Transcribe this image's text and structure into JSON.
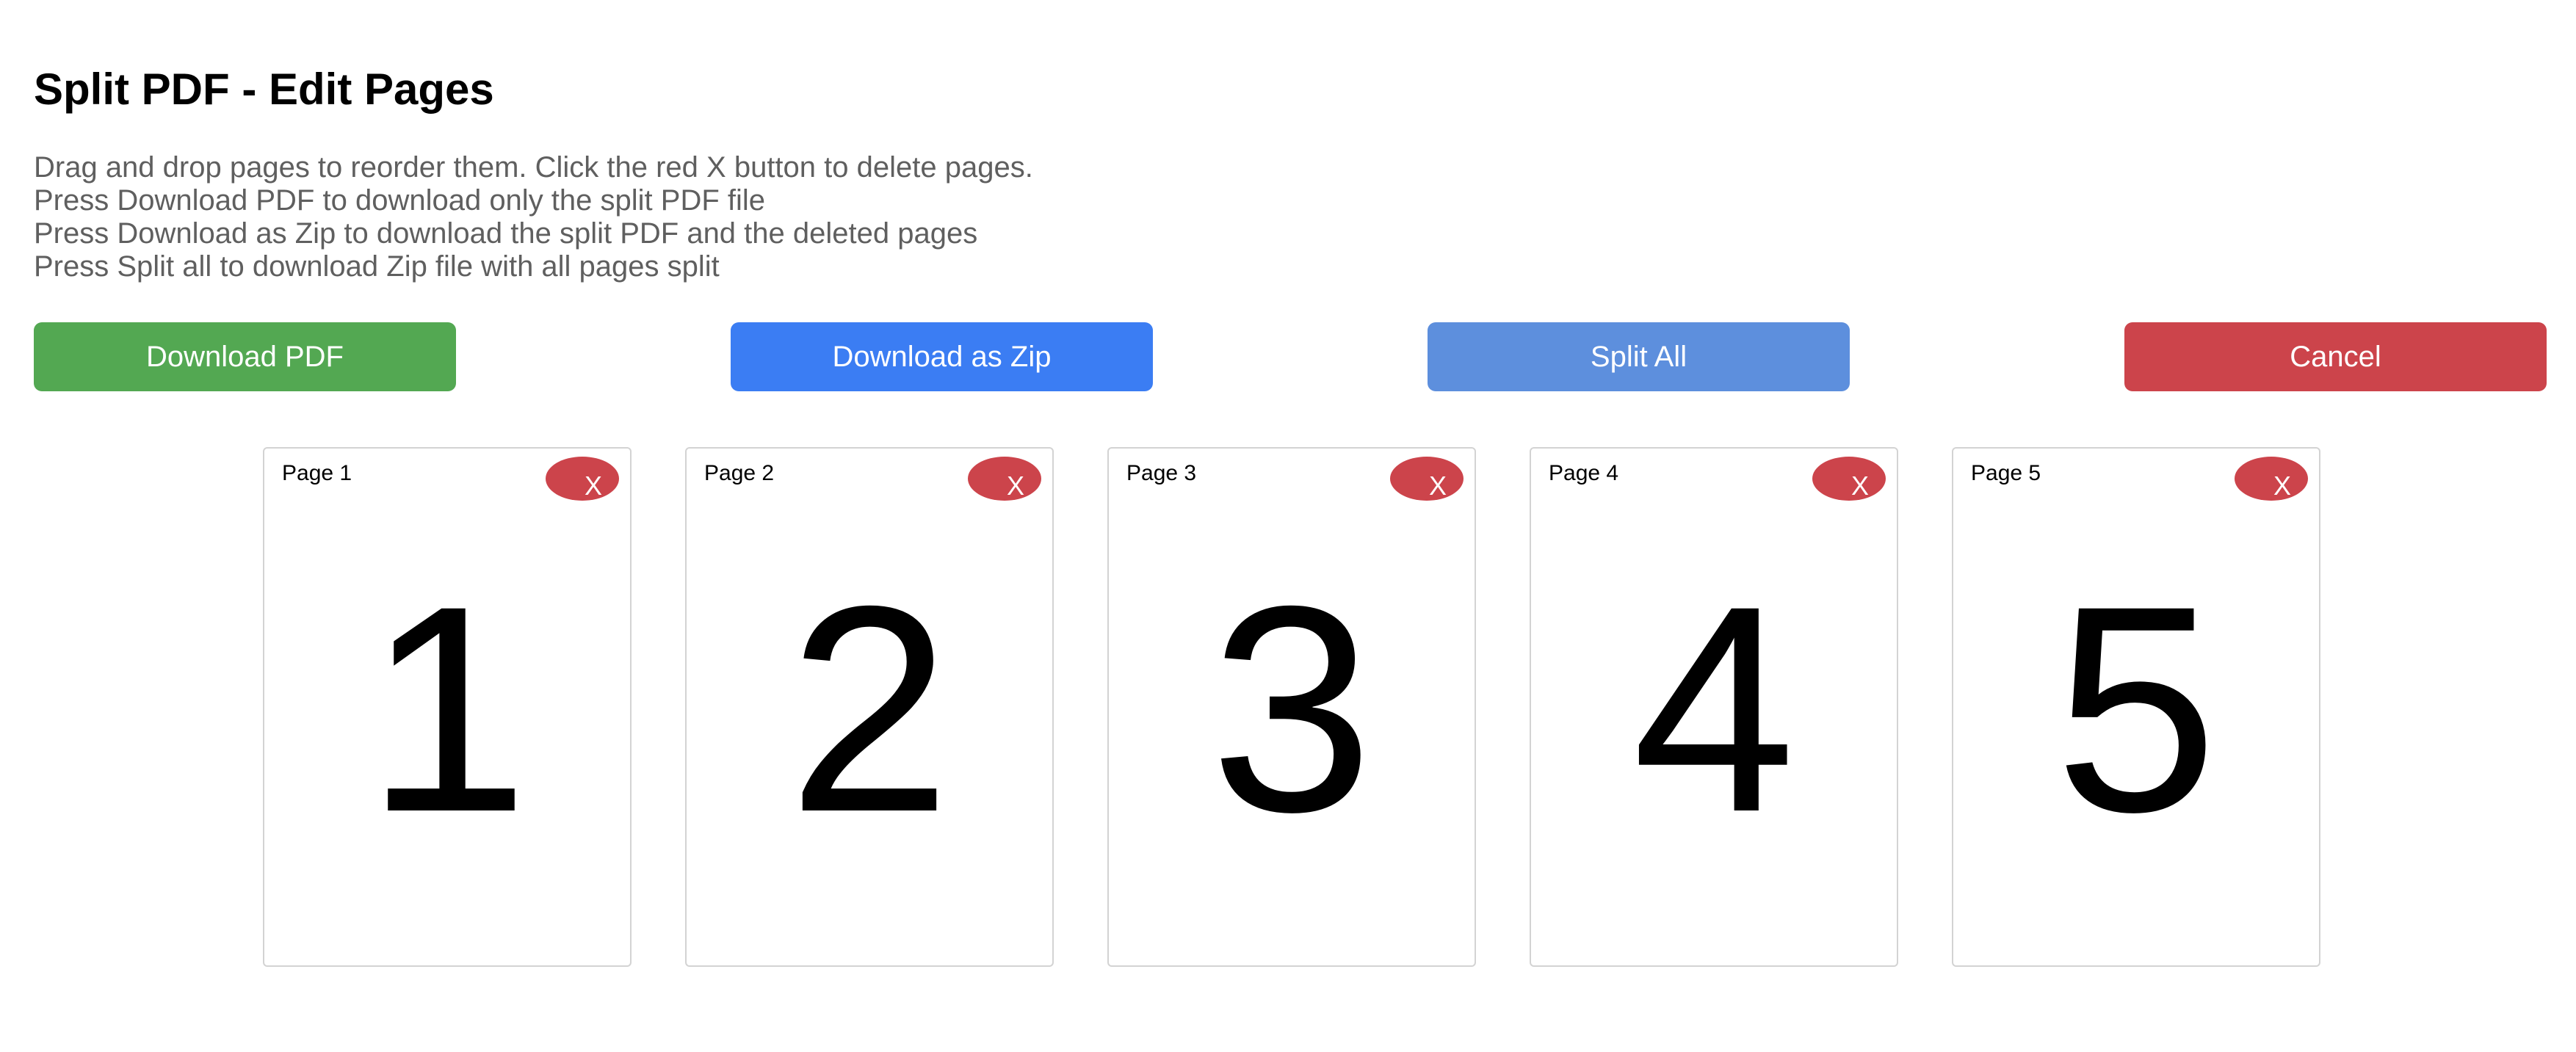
{
  "header": {
    "title": "Split PDF - Edit Pages"
  },
  "instructions": [
    "Drag and drop pages to reorder them. Click the red X button to delete pages.",
    "Press Download PDF to download only the split PDF file",
    "Press Download as Zip to download the split PDF and the deleted pages",
    "Press Split all to download Zip file with all pages split"
  ],
  "actions": {
    "download_pdf": {
      "label": "Download PDF",
      "color": "#53a852"
    },
    "download_zip": {
      "label": "Download as Zip",
      "color": "#3b7df3"
    },
    "split_all": {
      "label": "Split All",
      "color": "#5d8fdd"
    },
    "cancel": {
      "label": "Cancel",
      "color": "#cc444b"
    }
  },
  "pages": [
    {
      "label": "Page 1",
      "number": "1",
      "delete_label": "X"
    },
    {
      "label": "Page 2",
      "number": "2",
      "delete_label": "X"
    },
    {
      "label": "Page 3",
      "number": "3",
      "delete_label": "X"
    },
    {
      "label": "Page 4",
      "number": "4",
      "delete_label": "X"
    },
    {
      "label": "Page 5",
      "number": "5",
      "delete_label": "X"
    }
  ],
  "colors": {
    "delete": "#cc444b",
    "instruction_text": "#5f5f5f",
    "card_border": "#d3d3d3"
  }
}
